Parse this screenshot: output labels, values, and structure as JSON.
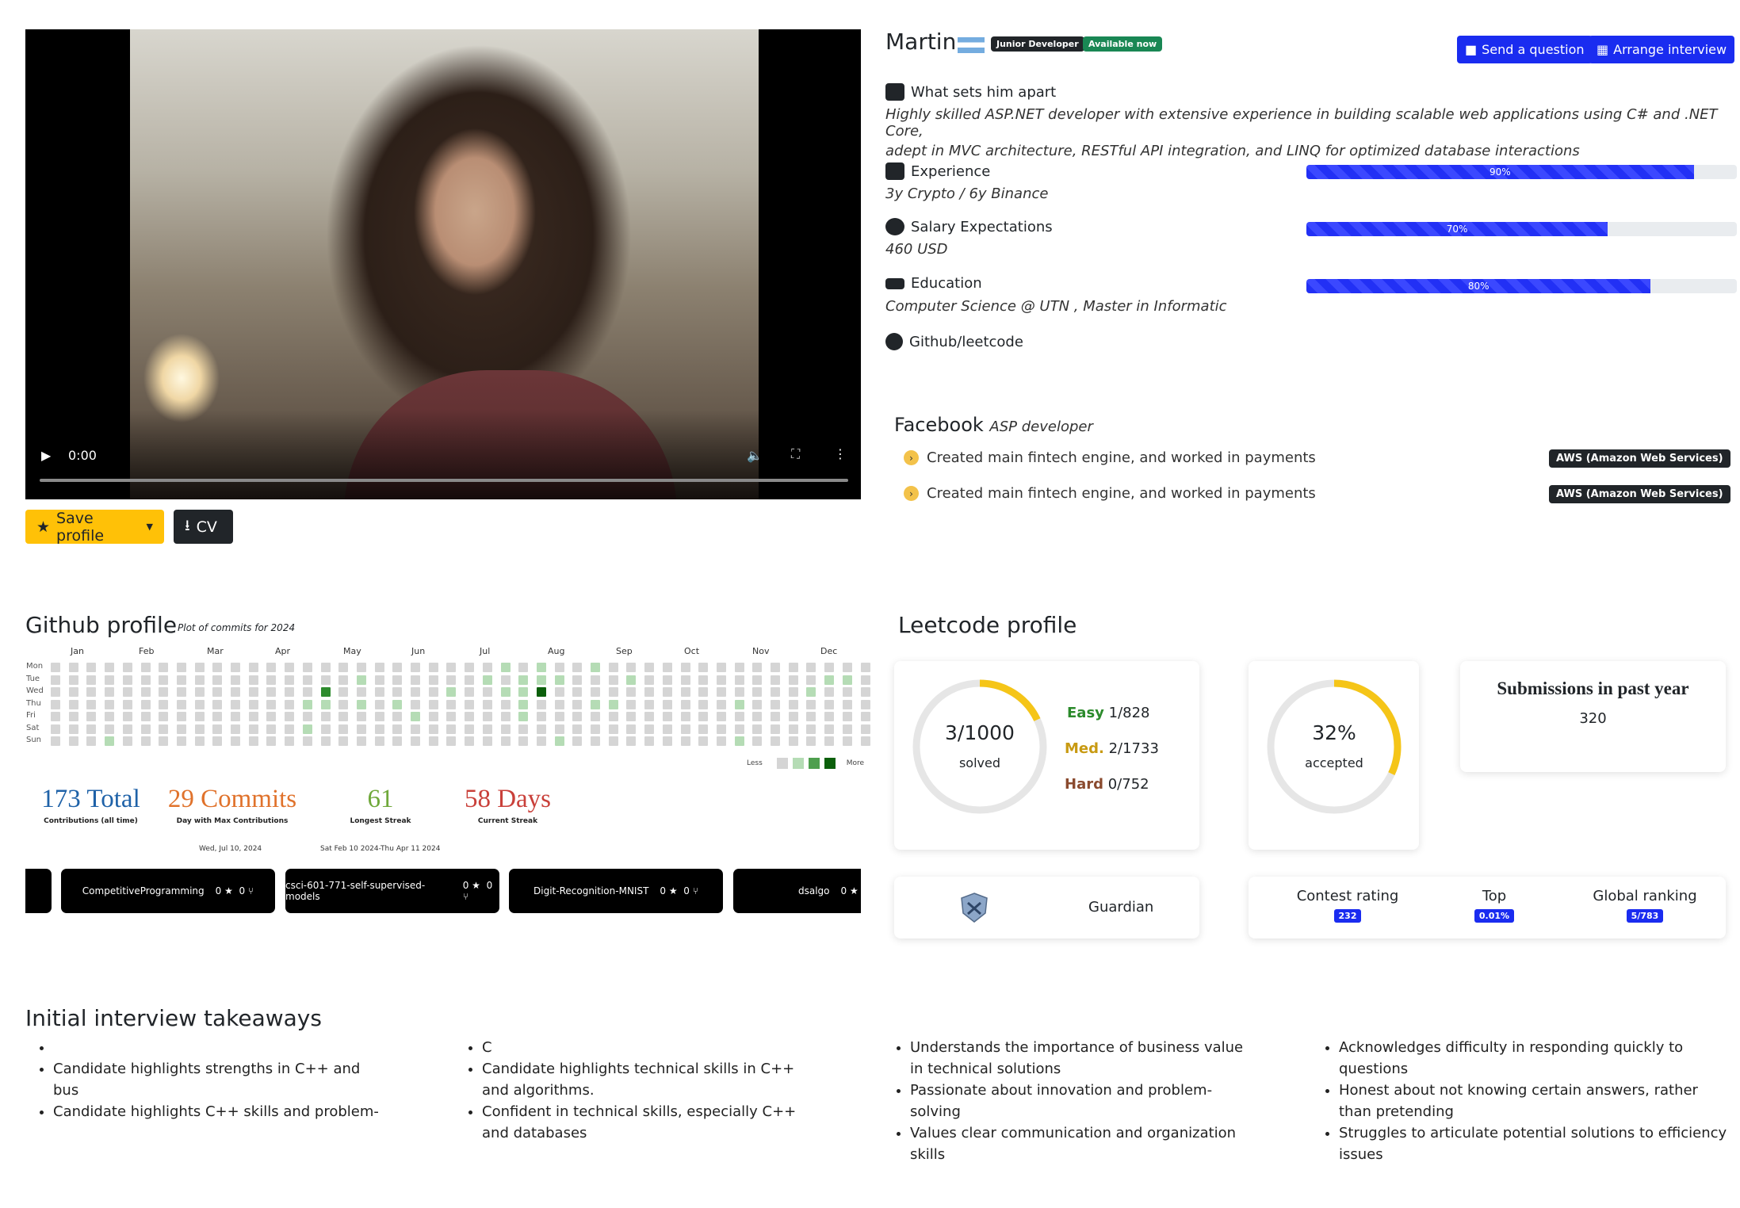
{
  "video": {
    "time": "0:00"
  },
  "actions": {
    "save_label": "Save profile",
    "cv_label": "CV"
  },
  "profile": {
    "name": "Martin",
    "level_badge": "Junior Developer",
    "availability_badge": "Available now",
    "ask_label": "Send a question",
    "interview_label": "Arrange interview"
  },
  "about": {
    "heading": "What sets him apart",
    "text_line1": "Highly skilled ASP.NET developer with extensive experience in building scalable web applications using C# and .NET Core,",
    "text_line2": "adept in MVC architecture, RESTful API integration, and LINQ for optimized database interactions"
  },
  "experience": {
    "heading": "Experience",
    "detail": "3y Crypto / 6y Binance",
    "percent": 90,
    "percent_label": "90%"
  },
  "salary": {
    "heading": "Salary Expectations",
    "detail": "460 USD",
    "percent": 70,
    "percent_label": "70%"
  },
  "education": {
    "heading": "Education",
    "detail": "Computer Science @ UTN , Master in Informatic",
    "percent": 80,
    "percent_label": "80%"
  },
  "github_link": {
    "label": "Github/leetcode"
  },
  "job": {
    "company": "Facebook",
    "role": "ASP developer",
    "items": [
      {
        "text": "Created main fintech engine, and worked in payments",
        "tag": "AWS (Amazon Web Services)"
      },
      {
        "text": "Created main fintech engine, and worked in payments",
        "tag": "AWS (Amazon Web Services)"
      }
    ]
  },
  "github": {
    "title": "Github profile",
    "subtitle": "Plot of commits for 2024",
    "months": [
      "Jan",
      "Feb",
      "Mar",
      "Apr",
      "May",
      "Jun",
      "Jul",
      "Aug",
      "Sep",
      "Oct",
      "Nov",
      "Dec"
    ],
    "days": [
      "Mon",
      "Tue",
      "Wed",
      "Thu",
      "Fri",
      "Sat",
      "Sun"
    ],
    "legend_less": "Less",
    "legend_more": "More",
    "colors": {
      "empty": "#d5d5d5",
      "l1": "#b5dcb5",
      "l2": "#7fc17f",
      "l3": "#2e8b2e",
      "l4": "#0b5f0b"
    },
    "active_cells": [
      {
        "week": 3,
        "day": 6,
        "level": 1
      },
      {
        "week": 15,
        "day": 2,
        "level": 3
      },
      {
        "week": 14,
        "day": 3,
        "level": 1
      },
      {
        "week": 15,
        "day": 3,
        "level": 1
      },
      {
        "week": 14,
        "day": 5,
        "level": 1
      },
      {
        "week": 17,
        "day": 1,
        "level": 1
      },
      {
        "week": 17,
        "day": 3,
        "level": 1
      },
      {
        "week": 19,
        "day": 3,
        "level": 1
      },
      {
        "week": 20,
        "day": 4,
        "level": 1
      },
      {
        "week": 22,
        "day": 2,
        "level": 1
      },
      {
        "week": 24,
        "day": 1,
        "level": 1
      },
      {
        "week": 25,
        "day": 0,
        "level": 1
      },
      {
        "week": 25,
        "day": 2,
        "level": 1
      },
      {
        "week": 26,
        "day": 1,
        "level": 1
      },
      {
        "week": 26,
        "day": 4,
        "level": 1
      },
      {
        "week": 27,
        "day": 0,
        "level": 1
      },
      {
        "week": 27,
        "day": 1,
        "level": 1
      },
      {
        "week": 27,
        "day": 2,
        "level": 1
      },
      {
        "week": 26,
        "day": 2,
        "level": 1
      },
      {
        "week": 26,
        "day": 3,
        "level": 1
      },
      {
        "week": 27,
        "day": 2,
        "level": 4
      },
      {
        "week": 28,
        "day": 1,
        "level": 1
      },
      {
        "week": 28,
        "day": 6,
        "level": 1
      },
      {
        "week": 30,
        "day": 0,
        "level": 1
      },
      {
        "week": 30,
        "day": 3,
        "level": 1
      },
      {
        "week": 31,
        "day": 3,
        "level": 1
      },
      {
        "week": 32,
        "day": 1,
        "level": 1
      },
      {
        "week": 38,
        "day": 3,
        "level": 1
      },
      {
        "week": 38,
        "day": 6,
        "level": 1
      },
      {
        "week": 42,
        "day": 2,
        "level": 1
      },
      {
        "week": 43,
        "day": 1,
        "level": 1
      },
      {
        "week": 44,
        "day": 1,
        "level": 1
      }
    ],
    "stats": [
      {
        "value": "173 Total",
        "label": "Contributions (all time)",
        "sub": "",
        "color": "#1f62a8"
      },
      {
        "value": "29 Commits",
        "label": "Day with Max Contributions",
        "sub": "Wed, Jul 10, 2024",
        "color": "#e0722b"
      },
      {
        "value": "61",
        "label": "Longest Streak",
        "sub": "Sat Feb 10 2024-Thu Apr 11 2024",
        "color": "#6fa83a"
      },
      {
        "value": "58 Days",
        "label": "Current Streak",
        "sub": "",
        "color": "#c9403a"
      }
    ],
    "repos": [
      {
        "name": "CompetitiveProgramming",
        "stars": "0",
        "forks": "0"
      },
      {
        "name": "csci-601-771-self-supervised-models",
        "stars": "0",
        "forks": "0"
      },
      {
        "name": "Digit-Recognition-MNIST",
        "stars": "0",
        "forks": "0"
      },
      {
        "name": "dsalgo",
        "stars": "0",
        "forks": ""
      }
    ]
  },
  "leetcode": {
    "title": "Leetcode profile",
    "solved_value": "3/1000",
    "solved_label": "solved",
    "solved_fraction": 0.18,
    "easy_label": "Easy",
    "easy_value": "1/828",
    "med_label": "Med.",
    "med_value": "2/1733",
    "hard_label": "Hard",
    "hard_value": "0/752",
    "accepted_value": "32%",
    "accepted_label": "accepted",
    "accepted_fraction": 0.32,
    "submissions_title": "Submissions in past year",
    "submissions_value": "320",
    "badge_name": "Guardian",
    "contest_label": "Contest rating",
    "contest_value": "232",
    "top_label": "Top",
    "top_value": "0.01%",
    "ranking_label": "Global ranking",
    "ranking_value": "5/783",
    "accent": "#f5c518"
  },
  "takeaways": {
    "title": "Initial interview takeaways",
    "columns": [
      [
        "",
        "Candidate highlights strengths in C++ and bus",
        "Candidate highlights C++ skills and problem-"
      ],
      [
        "C",
        "Candidate highlights technical skills in C++ and algorithms.",
        "Confident in technical skills, especially C++ and databases"
      ],
      [
        "Understands the importance of business value in technical solutions",
        "Passionate about innovation and problem-solving",
        "Values clear communication and organization skills"
      ],
      [
        "Acknowledges difficulty in responding quickly to questions",
        "Honest about not knowing certain answers, rather than pretending",
        "Struggles to articulate potential solutions to efficiency issues"
      ]
    ]
  }
}
